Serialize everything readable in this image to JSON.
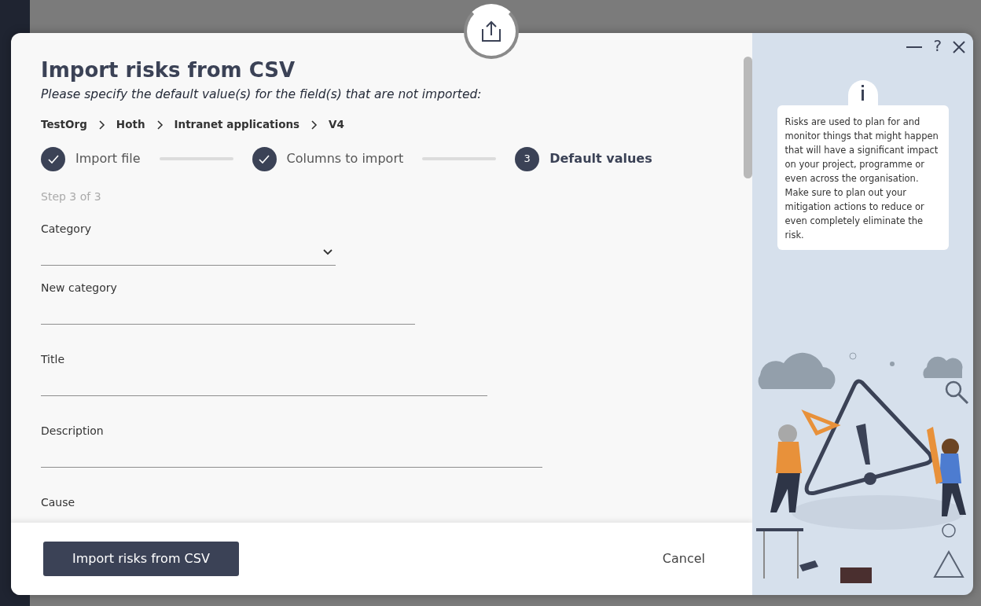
{
  "dialog": {
    "title": "Import risks from CSV",
    "subtitle": "Please specify the default value(s) for the field(s) that are not imported:",
    "breadcrumb": [
      "TestOrg",
      "Hoth",
      "Intranet applications",
      "V4"
    ],
    "steps": [
      {
        "label": "Import file",
        "kind": "done"
      },
      {
        "label": "Columns to import",
        "kind": "done"
      },
      {
        "label": "Default values",
        "kind": "current",
        "number": "3"
      }
    ],
    "step_counter": "Step 3 of 3",
    "fields": [
      {
        "label": "Category",
        "kind": "select"
      },
      {
        "label": "New category",
        "kind": "text"
      },
      {
        "label": "Title",
        "kind": "text"
      },
      {
        "label": "Description",
        "kind": "text"
      },
      {
        "label": "Cause"
      }
    ],
    "primary_button": "Import risks from CSV",
    "cancel_button": "Cancel"
  },
  "help_panel": {
    "help_button": "?",
    "info_text": "Risks are used to plan for and monitor things that might happen that will have a significant impact on your project, programme or even across the organisation. Make sure to plan out your mitigation actions to reduce or even completely eliminate the risk."
  }
}
